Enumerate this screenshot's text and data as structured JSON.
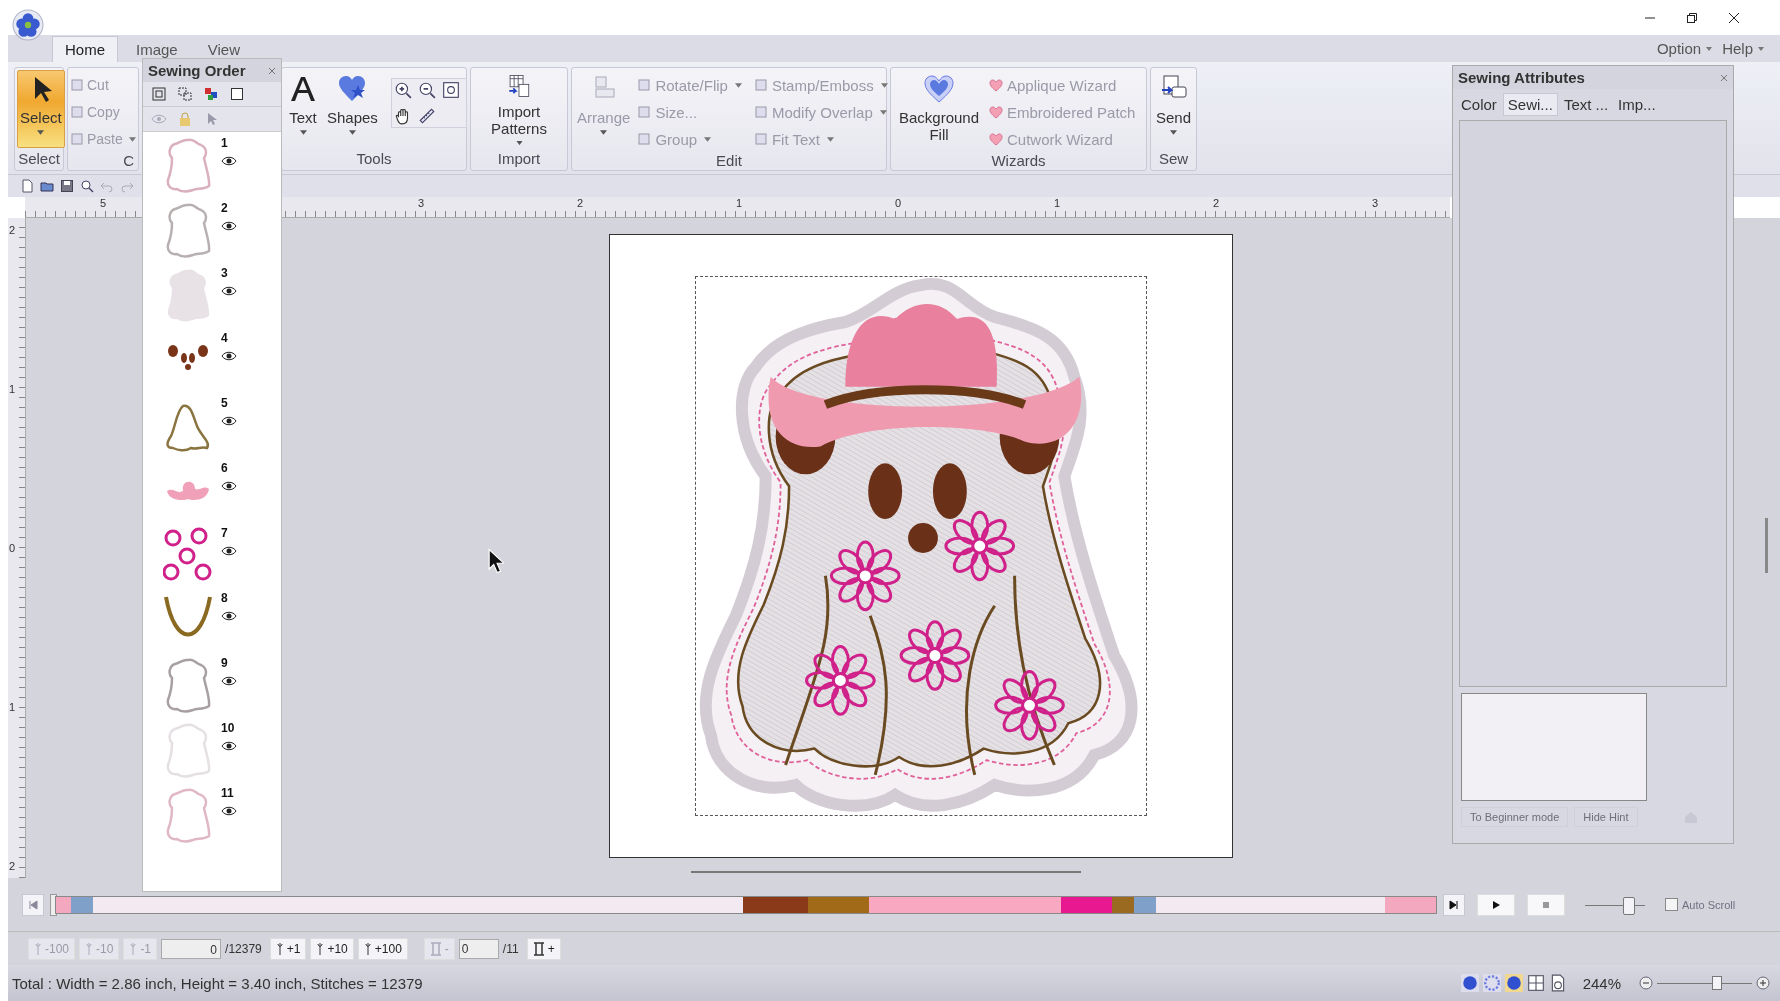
{
  "tabs": [
    {
      "label": "Home",
      "selected": true
    },
    {
      "label": "Image",
      "selected": false
    },
    {
      "label": "View",
      "selected": false
    }
  ],
  "menu": [
    "Option",
    "Help"
  ],
  "ribbon": [
    {
      "label": "Select",
      "items": [
        {
          "label": "Select",
          "kind": "large",
          "selected": true,
          "disabled": false,
          "dropdown": true
        }
      ]
    },
    {
      "label": "C",
      "items": [
        {
          "label": "Cut",
          "kind": "small",
          "selected": false,
          "disabled": true,
          "dropdown": false
        },
        {
          "label": "Copy",
          "kind": "small",
          "selected": false,
          "disabled": true,
          "dropdown": false
        },
        {
          "label": "Paste",
          "kind": "small",
          "selected": false,
          "disabled": true,
          "dropdown": true
        }
      ]
    },
    {
      "label": "Tools",
      "items": [
        {
          "label": "Text",
          "kind": "large",
          "selected": false,
          "disabled": false,
          "dropdown": true
        },
        {
          "label": "Shapes",
          "kind": "large",
          "selected": false,
          "disabled": false,
          "dropdown": true
        }
      ]
    },
    {
      "label": "Import",
      "items": [
        {
          "label": "Import Patterns",
          "kind": "large",
          "selected": false,
          "disabled": false,
          "dropdown": true
        }
      ]
    },
    {
      "label": "Edit",
      "items": [
        {
          "label": "Arrange",
          "kind": "large",
          "selected": false,
          "disabled": true,
          "dropdown": true
        },
        {
          "label": "Rotate/Flip",
          "kind": "small",
          "selected": false,
          "disabled": true,
          "dropdown": true
        },
        {
          "label": "Size...",
          "kind": "small",
          "selected": false,
          "disabled": true,
          "dropdown": false
        },
        {
          "label": "Group",
          "kind": "small",
          "selected": false,
          "disabled": true,
          "dropdown": true
        },
        {
          "label": "Stamp/Emboss",
          "kind": "small",
          "selected": false,
          "disabled": true,
          "dropdown": true
        },
        {
          "label": "Modify Overlap",
          "kind": "small",
          "selected": false,
          "disabled": true,
          "dropdown": true
        },
        {
          "label": "Fit Text",
          "kind": "small",
          "selected": false,
          "disabled": true,
          "dropdown": true
        }
      ]
    },
    {
      "label": "Wizards",
      "items": [
        {
          "label": "Background Fill",
          "kind": "large",
          "selected": false,
          "disabled": false,
          "dropdown": false
        },
        {
          "label": "Applique Wizard",
          "kind": "small",
          "selected": false,
          "disabled": true,
          "dropdown": false
        },
        {
          "label": "Embroidered Patch",
          "kind": "small",
          "selected": false,
          "disabled": true,
          "dropdown": false
        },
        {
          "label": "Cutwork Wizard",
          "kind": "small",
          "selected": false,
          "disabled": true,
          "dropdown": false
        }
      ]
    },
    {
      "label": "Sew",
      "items": [
        {
          "label": "Send",
          "kind": "large",
          "selected": false,
          "disabled": false,
          "dropdown": true
        }
      ]
    }
  ],
  "sewing_order": {
    "title": "Sewing Order",
    "items": [
      {
        "number": "1",
        "kind": "outline",
        "color": "#d9b0bc"
      },
      {
        "number": "2",
        "kind": "outline",
        "color": "#b8b0b0"
      },
      {
        "number": "3",
        "kind": "fill",
        "color": "#e8e2e6"
      },
      {
        "number": "4",
        "kind": "ears",
        "color": "#7a3418"
      },
      {
        "number": "5",
        "kind": "body",
        "color": "#8a7440"
      },
      {
        "number": "6",
        "kind": "hat",
        "color": "#f0a0b8"
      },
      {
        "number": "7",
        "kind": "flowers",
        "color": "#d0208a"
      },
      {
        "number": "8",
        "kind": "mouth",
        "color": "#8a6a20"
      },
      {
        "number": "9",
        "kind": "outline",
        "color": "#a8a0a0"
      },
      {
        "number": "10",
        "kind": "outline",
        "color": "#e4e0e4"
      },
      {
        "number": "11",
        "kind": "outline",
        "color": "#e0b8c4"
      }
    ]
  },
  "ruler": {
    "horizontal": [
      "5",
      "3",
      "2",
      "1",
      "0",
      "1",
      "2",
      "3"
    ],
    "vertical": [
      "2",
      "1",
      "0",
      "1",
      "2"
    ]
  },
  "sewing_attributes": {
    "title": "Sewing Attributes",
    "tabs": [
      {
        "label": "Color",
        "selected": false
      },
      {
        "label": "Sewi...",
        "selected": true
      },
      {
        "label": "Text ...",
        "selected": false
      },
      {
        "label": "Imp...",
        "selected": false
      }
    ],
    "hint_buttons": [
      {
        "label": "To Beginner mode",
        "disabled": true
      },
      {
        "label": "Hide Hint",
        "disabled": true
      }
    ]
  },
  "timeline": {
    "segments": [
      {
        "color": "#f4a8c0"
      },
      {
        "color": "#7fa0c8"
      },
      {
        "color": "#f2eaf0"
      },
      {
        "color": "#8a3a18"
      },
      {
        "color": "#a06a18"
      },
      {
        "color": "#f8a8c0"
      },
      {
        "color": "#e81890"
      },
      {
        "color": "#9a6a20"
      },
      {
        "color": "#7fa0c8"
      },
      {
        "color": "#f2eaf0"
      },
      {
        "color": "#f4a8c0"
      }
    ],
    "speed": {
      "level": 0.72
    },
    "auto_scroll": {
      "label": "Auto Scroll",
      "checked": false
    }
  },
  "stitch_controls": {
    "back": [
      {
        "label": "-100",
        "disabled": true
      },
      {
        "label": "-10",
        "disabled": true
      },
      {
        "label": "-1",
        "disabled": true
      }
    ],
    "stitch_value": "0",
    "stitch_total": "/12379",
    "forward": [
      {
        "label": "+1",
        "disabled": false
      },
      {
        "label": "+10",
        "disabled": false
      },
      {
        "label": "+100",
        "disabled": false
      }
    ],
    "color_back": {
      "label": "-",
      "disabled": true
    },
    "color_value": "0",
    "color_total": "/11",
    "color_forward": {
      "label": "+",
      "disabled": false
    }
  },
  "status_bar": {
    "text": "Total : Width = 2.86 inch, Height = 3.40 inch, Stitches = 12379",
    "zoom": "244%",
    "zoom_slider": {
      "level": 0.62
    }
  }
}
